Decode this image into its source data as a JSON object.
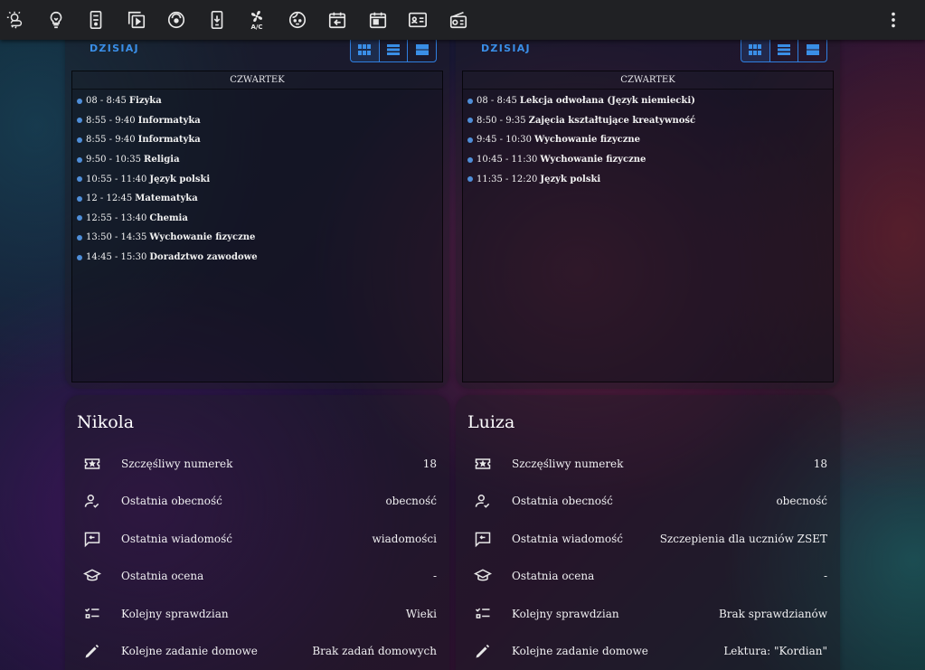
{
  "toolbar": {
    "icons": [
      "weather-icon",
      "lightbulb-icon",
      "tv-remote-icon",
      "media-playlist-icon",
      "robot-vacuum-icon",
      "phone-download-icon",
      "air-conditioner-icon",
      "baby-face-icon",
      "calendar-arrow-icon",
      "calendar-today-icon",
      "id-card-icon",
      "radio-icon"
    ],
    "fan_label": "A/C",
    "menu_icon": "dots-vertical-icon"
  },
  "timetables": [
    {
      "today_label": "DZISIAJ",
      "day": "CZWARTEK",
      "lessons": [
        {
          "time": "08 - 8:45",
          "subject": "Fizyka"
        },
        {
          "time": "8:55 - 9:40",
          "subject": "Informatyka"
        },
        {
          "time": "8:55 - 9:40",
          "subject": "Informatyka"
        },
        {
          "time": "9:50 - 10:35",
          "subject": "Religia"
        },
        {
          "time": "10:55 - 11:40",
          "subject": "Język polski"
        },
        {
          "time": "12 - 12:45",
          "subject": "Matematyka"
        },
        {
          "time": "12:55 - 13:40",
          "subject": "Chemia"
        },
        {
          "time": "13:50 - 14:35",
          "subject": "Wychowanie fizyczne"
        },
        {
          "time": "14:45 - 15:30",
          "subject": "Doradztwo zawodowe"
        }
      ]
    },
    {
      "today_label": "DZISIAJ",
      "day": "CZWARTEK",
      "lessons": [
        {
          "time": "08 - 8:45",
          "subject": "Lekcja odwołana (Język niemiecki)"
        },
        {
          "time": "8:50 - 9:35",
          "subject": "Zajęcia kształtujące kreatywność"
        },
        {
          "time": "9:45 - 10:30",
          "subject": "Wychowanie fizyczne"
        },
        {
          "time": "10:45 - 11:30",
          "subject": "Wychowanie fizyczne"
        },
        {
          "time": "11:35 - 12:20",
          "subject": "Język polski"
        }
      ]
    }
  ],
  "students": [
    {
      "name": "Nikola",
      "rows": [
        {
          "icon": "ticket-icon",
          "label": "Szczęśliwy numerek",
          "value": "18"
        },
        {
          "icon": "account-check-icon",
          "label": "Ostatnia obecność",
          "value": "obecność"
        },
        {
          "icon": "message-arrow-icon",
          "label": "Ostatnia wiadomość",
          "value": "wiadomości"
        },
        {
          "icon": "school-cap-icon",
          "label": "Ostatnia ocena",
          "value": "-"
        },
        {
          "icon": "checklist-icon",
          "label": "Kolejny sprawdzian",
          "value": "Wieki"
        },
        {
          "icon": "pen-icon",
          "label": "Kolejne zadanie domowe",
          "value": "Brak zadań domowych"
        }
      ]
    },
    {
      "name": "Luiza",
      "rows": [
        {
          "icon": "ticket-icon",
          "label": "Szczęśliwy numerek",
          "value": "18"
        },
        {
          "icon": "account-check-icon",
          "label": "Ostatnia obecność",
          "value": "obecność"
        },
        {
          "icon": "message-arrow-icon",
          "label": "Ostatnia wiadomość",
          "value": "Szczepienia dla uczniów ZSET"
        },
        {
          "icon": "school-cap-icon",
          "label": "Ostatnia ocena",
          "value": "-"
        },
        {
          "icon": "checklist-icon",
          "label": "Kolejny sprawdzian",
          "value": "Brak sprawdzianów"
        },
        {
          "icon": "pen-icon",
          "label": "Kolejne zadanie domowe",
          "value": "Lektura: \"Kordian\""
        }
      ]
    }
  ],
  "colors": {
    "accent": "#3a8fe8",
    "toolbar_bg": "#202124",
    "lesson_dot": "#4f8ed8"
  }
}
